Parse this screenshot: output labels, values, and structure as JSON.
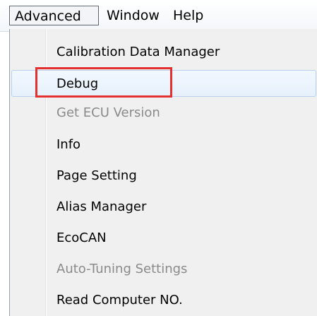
{
  "menubar": {
    "items": [
      {
        "label": "Advanced"
      },
      {
        "label": "Window"
      },
      {
        "label": "Help"
      }
    ]
  },
  "dropdown": {
    "items": [
      {
        "label": "Calibration Data Manager",
        "enabled": true
      },
      {
        "label": "Debug",
        "enabled": true,
        "hovered": true
      },
      {
        "label": "Get ECU Version",
        "enabled": false
      },
      {
        "label": "Info",
        "enabled": true
      },
      {
        "label": "Page Setting",
        "enabled": true
      },
      {
        "label": "Alias Manager",
        "enabled": true
      },
      {
        "label": "EcoCAN",
        "enabled": true
      },
      {
        "label": "Auto-Tuning Settings",
        "enabled": false
      },
      {
        "label": "Read Computer NO.",
        "enabled": true
      }
    ]
  },
  "colors": {
    "annotation_box": "#e53030",
    "disabled_text": "#8a8a8a",
    "hover_border": "#b9d1ef"
  }
}
